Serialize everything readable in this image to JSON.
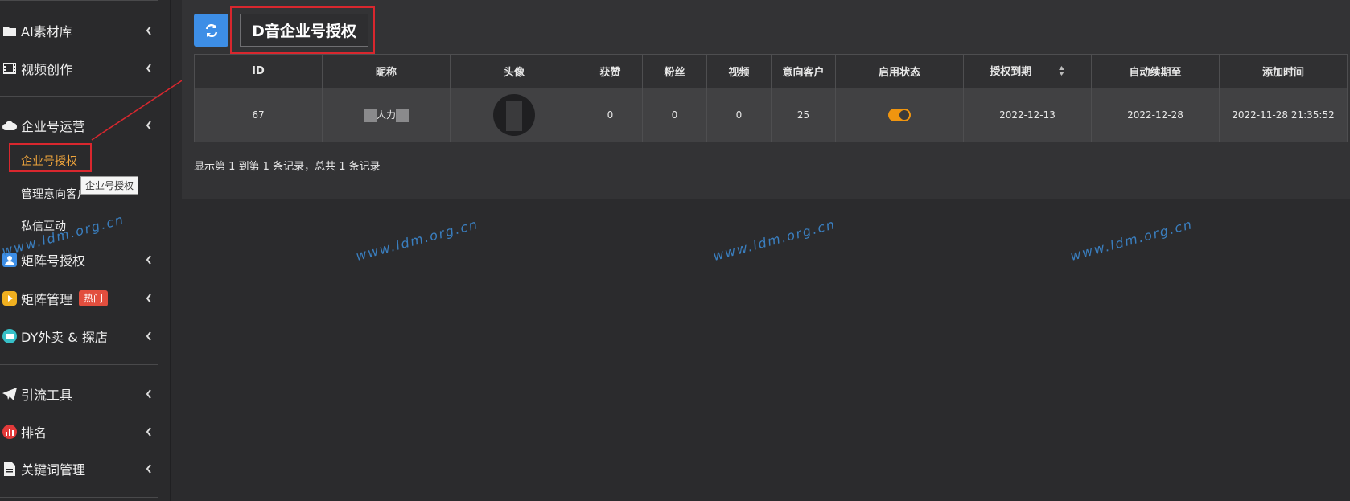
{
  "sidebar": {
    "items": [
      {
        "label": "AI素材库",
        "icon": "folder-icon"
      },
      {
        "label": "视频创作",
        "icon": "film-icon"
      },
      {
        "label": "企业号运营",
        "icon": "cloud-icon"
      },
      {
        "label": "矩阵号授权",
        "icon": "user-icon"
      },
      {
        "label": "矩阵管理",
        "icon": "play-icon",
        "badge": "热门"
      },
      {
        "label": "DY外卖 & 探店",
        "icon": "store-icon"
      },
      {
        "label": "引流工具",
        "icon": "send-icon"
      },
      {
        "label": "排名",
        "icon": "bar-chart-icon"
      },
      {
        "label": "关键词管理",
        "icon": "document-icon"
      }
    ],
    "subitems": [
      {
        "label": "企业号授权",
        "active": true
      },
      {
        "label": "管理意向客户"
      },
      {
        "label": "私信互动"
      }
    ],
    "tooltip": "企业号授权"
  },
  "toolbar": {
    "refresh_icon": "refresh-icon",
    "title": "D音企业号授权"
  },
  "table": {
    "headers": [
      "ID",
      "昵称",
      "头像",
      "获赞",
      "粉丝",
      "视频",
      "意向客户",
      "启用状态",
      "授权到期",
      "自动续期至",
      "添加时间"
    ],
    "rows": [
      {
        "id": "67",
        "nickname": "人力",
        "likes": "0",
        "fans": "0",
        "videos": "0",
        "leads": "25",
        "enabled": true,
        "auth_expire": "2022-12-13",
        "auto_renew": "2022-12-28",
        "added": "2022-11-28 21:35:52"
      }
    ]
  },
  "footer": {
    "records": "显示第 1 到第 1 条记录，总共 1 条记录"
  },
  "watermark": "www.ldm.org.cn",
  "colors": {
    "accent": "#3d8ee6",
    "active": "#f0a53c",
    "highlight": "#d9272e",
    "hot_badge": "#e24e3e",
    "toggle_on": "#f0950f"
  }
}
